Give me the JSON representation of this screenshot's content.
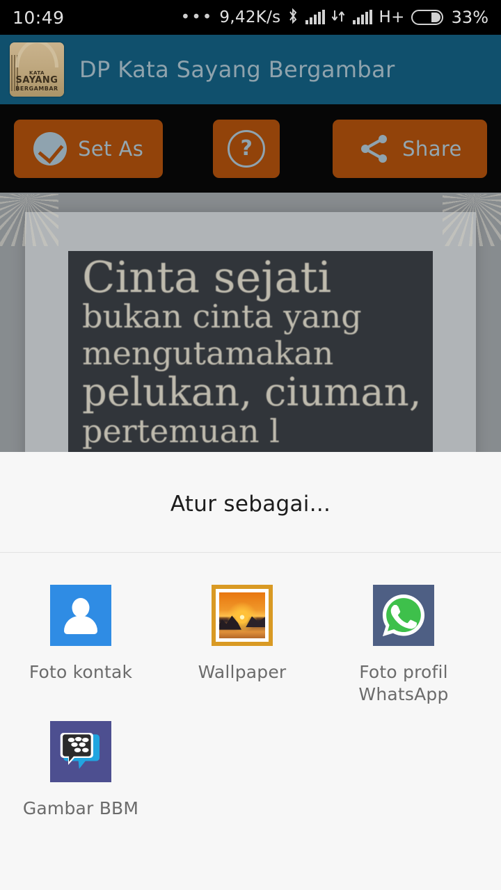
{
  "status_bar": {
    "time": "10:49",
    "dots": "•••",
    "network_speed": "9,42K/s",
    "bluetooth_icon": "bluetooth-icon",
    "signal_icon": "signal-bars-icon",
    "data_transfer_icon": "data-transfer-icon",
    "network_type": "H+",
    "battery_icon": "battery-icon",
    "battery_percent": "33%"
  },
  "app_bar": {
    "icon": "app-logo-icon",
    "icon_text_top": "KATA",
    "icon_text_mid": "SAYANG",
    "icon_text_bottom": "BERGAMBAR",
    "title": "DP Kata Sayang Bergambar",
    "background": "#10506d",
    "title_color": "#8fa3ad"
  },
  "action_bar": {
    "background": "#060606",
    "button_color": "#92430a",
    "label_color": "#93a7b2",
    "set_as": {
      "label": "Set As",
      "icon": "check-circle-icon"
    },
    "help": {
      "label": "?",
      "icon": "question-circle-icon"
    },
    "share": {
      "label": "Share",
      "icon": "share-icon"
    }
  },
  "image_preview": {
    "name": "quote-image-preview",
    "quote_lines": [
      "Cinta sejati",
      "bukan cinta yang",
      "mengutamakan",
      "pelukan, ciuman,",
      "pertemuan l"
    ]
  },
  "sheet": {
    "title": "Atur sebagai...",
    "options": [
      {
        "label": "Foto kontak",
        "icon": "contact-photo-icon",
        "color": "#2f8ce4"
      },
      {
        "label": "Wallpaper",
        "icon": "wallpaper-icon",
        "color": "#d99a24"
      },
      {
        "label": "Foto profil WhatsApp",
        "icon": "whatsapp-icon",
        "color": "#4e5f84"
      },
      {
        "label": "Gambar BBM",
        "icon": "bbm-icon",
        "color": "#4d4f90"
      }
    ]
  }
}
